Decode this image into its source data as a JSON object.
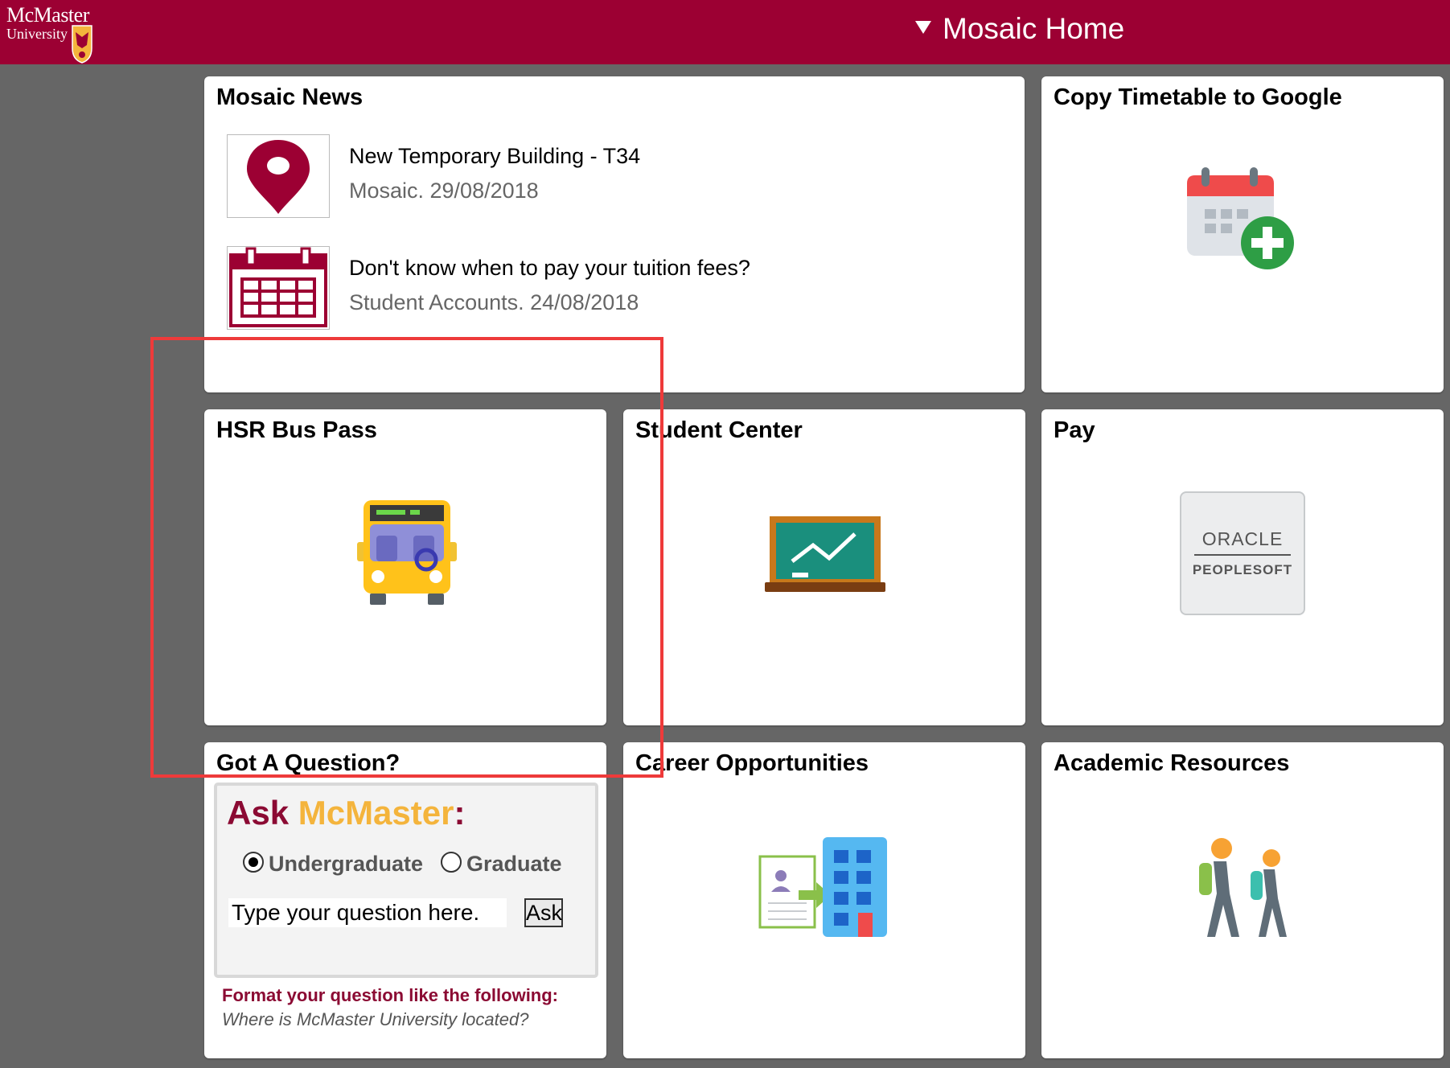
{
  "header": {
    "logo_line1": "McMaster",
    "logo_line2": "University",
    "title": "Mosaic Home",
    "title_icon": "caret-down-icon"
  },
  "tiles": {
    "news": {
      "title": "Mosaic News",
      "items": [
        {
          "title": "New Temporary Building - T34",
          "source": "Mosaic. 29/08/2018",
          "icon": "location-pin-icon"
        },
        {
          "title": "Don't know when to pay your tuition fees?",
          "source": "Student Accounts. 24/08/2018",
          "icon": "calendar-icon"
        }
      ]
    },
    "timetable": {
      "title": "Copy Timetable to Google",
      "icon": "calendar-add-icon"
    },
    "bus": {
      "title": "HSR Bus Pass",
      "icon": "bus-icon"
    },
    "student_center": {
      "title": "Student Center",
      "icon": "chalkboard-icon"
    },
    "pay": {
      "title": "Pay",
      "logo_line1": "ORACLE",
      "logo_line2": "PEOPLESOFT"
    },
    "question": {
      "title": "Got A Question?",
      "ask_word": "Ask ",
      "brand_word": "McMaster",
      "colon": ":",
      "radio_undergrad": "Undergraduate",
      "radio_grad": "Graduate",
      "input_value": "Type your question here.",
      "ask_button": "Ask",
      "hint_line1": "Format your question like the following:",
      "hint_line2": "Where is McMaster University located?"
    },
    "career": {
      "title": "Career Opportunities",
      "icon": "career-building-icon"
    },
    "academic": {
      "title": "Academic Resources",
      "icon": "students-walking-icon"
    }
  },
  "colors": {
    "brand": "#9c0033",
    "gold": "#f4b43c",
    "highlight": "#ee3a3a",
    "background": "#666666"
  }
}
